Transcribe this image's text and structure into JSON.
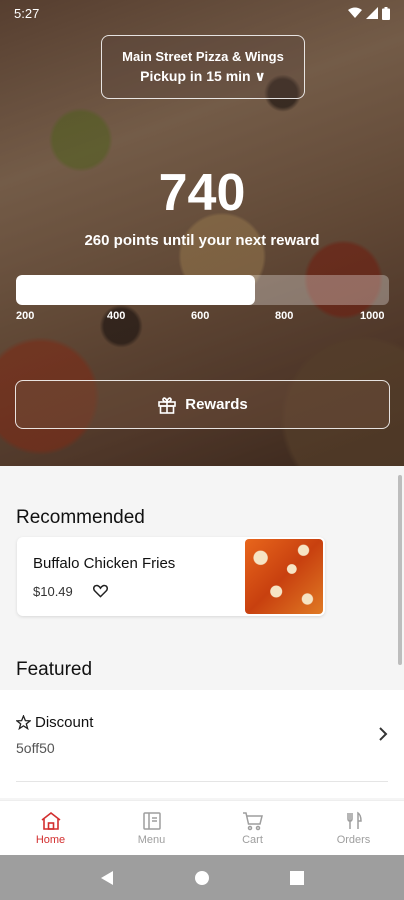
{
  "status_bar": {
    "time": "5:27"
  },
  "store": {
    "name": "Main Street Pizza & Wings",
    "pickup": "Pickup in 15 min ∨"
  },
  "loyalty": {
    "points": "740",
    "subtitle": "260 points until your next reward",
    "progress_percent": 64,
    "ticks": [
      "200",
      "400",
      "600",
      "800",
      "1000"
    ],
    "rewards_label": "Rewards"
  },
  "recommended": {
    "title": "Recommended",
    "items": [
      {
        "name": "Buffalo Chicken Fries",
        "price": "$10.49"
      }
    ]
  },
  "featured": {
    "title": "Featured",
    "items": [
      {
        "title": "Discount",
        "subtitle": "5off50"
      }
    ]
  },
  "nav": {
    "items": [
      {
        "label": "Home",
        "icon": "home-icon",
        "active": true
      },
      {
        "label": "Menu",
        "icon": "menu-icon",
        "active": false
      },
      {
        "label": "Cart",
        "icon": "cart-icon",
        "active": false
      },
      {
        "label": "Orders",
        "icon": "orders-icon",
        "active": false
      }
    ]
  },
  "colors": {
    "accent": "#d32f2f",
    "inactive": "#9e9e9e"
  }
}
